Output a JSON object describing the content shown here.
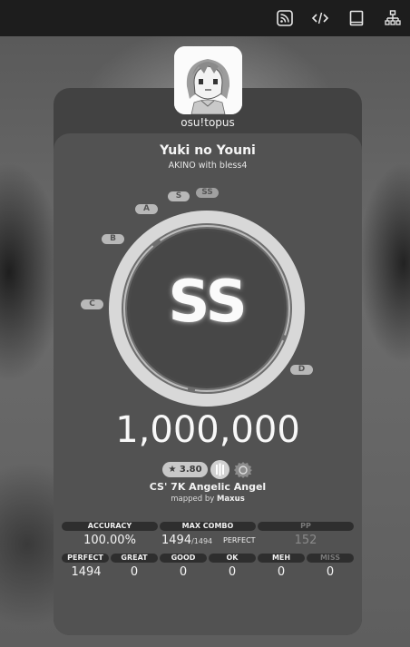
{
  "toolbar": {
    "icons": [
      "rss-icon",
      "code-icon",
      "book-icon",
      "tree-icon"
    ]
  },
  "player": {
    "username": "osu!topus"
  },
  "beatmap": {
    "title": "Yuki no Youni",
    "artist": "AKINO with bless4",
    "difficulty": "CS' 7K Angelic Angel",
    "mapped_by_label": "mapped by",
    "mapper": "Maxus",
    "stars": "★ 3.80"
  },
  "grades": {
    "ss": "SS",
    "s": "S",
    "a": "A",
    "b": "B",
    "c": "C",
    "d": "D"
  },
  "result": {
    "grade": "SS",
    "score": "1,000,000"
  },
  "stats_top": {
    "accuracy": {
      "label": "ACCURACY",
      "value": "100.00%"
    },
    "max_combo": {
      "label": "MAX COMBO",
      "value": "1494",
      "max": "/1494",
      "tag": "PERFECT"
    },
    "pp": {
      "label": "PP",
      "value": "152"
    }
  },
  "stats_bottom": [
    {
      "label": "PERFECT",
      "value": "1494"
    },
    {
      "label": "GREAT",
      "value": "0"
    },
    {
      "label": "GOOD",
      "value": "0"
    },
    {
      "label": "OK",
      "value": "0"
    },
    {
      "label": "MEH",
      "value": "0"
    },
    {
      "label": "MISS",
      "value": "0"
    }
  ],
  "colors": {
    "topbar": "#1d1d1d",
    "card": "#525252",
    "ring": "#d8d8d8"
  }
}
